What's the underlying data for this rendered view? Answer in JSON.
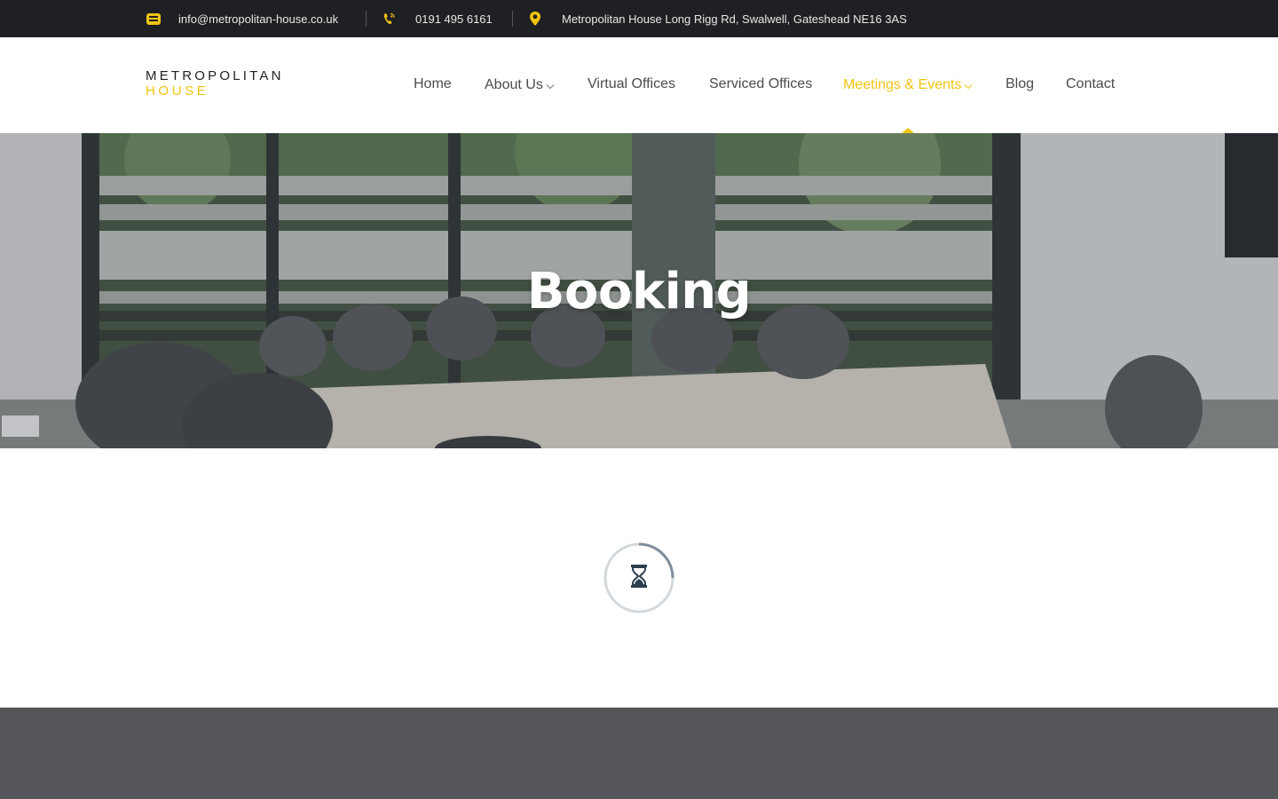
{
  "topbar": {
    "email": "info@metropolitan-house.co.uk",
    "email_icon": "envelope-icon",
    "phone": "0191 495 6161",
    "phone_icon": "phone-icon",
    "address": "Metropolitan House Long Rigg Rd, Swalwell, Gateshead NE16 3AS",
    "address_icon": "map-pin-icon"
  },
  "logo": {
    "line1": "METROPOLITAN",
    "line2": "HOUSE"
  },
  "nav": {
    "items": [
      {
        "label": "Home"
      },
      {
        "label": "About Us",
        "dropdown": true
      },
      {
        "label": "Virtual Offices"
      },
      {
        "label": "Serviced Offices"
      },
      {
        "label": "Meetings & Events",
        "dropdown": true,
        "active": true
      },
      {
        "label": "Blog"
      },
      {
        "label": "Contact"
      }
    ]
  },
  "hero": {
    "title": "Booking"
  },
  "loader": {
    "icon": "hourglass-icon"
  },
  "colors": {
    "accent": "#f1c40f",
    "topbar_bg": "#1f2023",
    "footer_bg": "#54565a",
    "nav_text": "#4b4b4b"
  }
}
